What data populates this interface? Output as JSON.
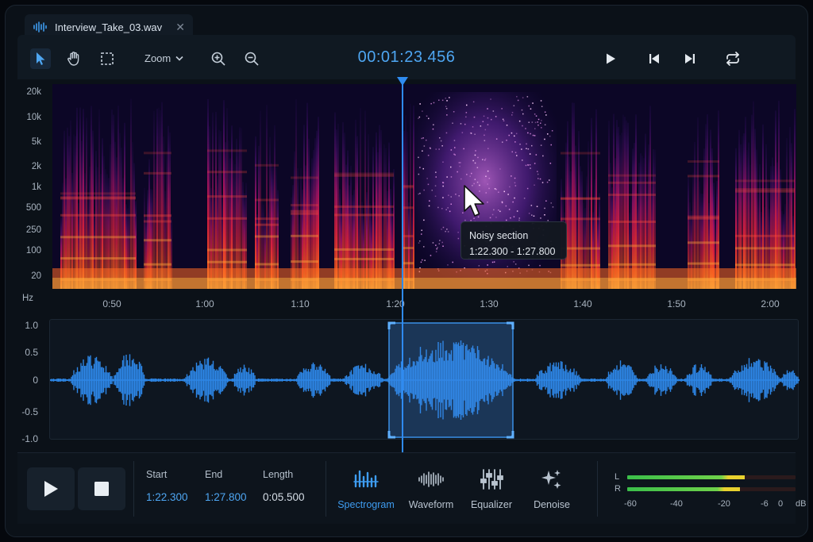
{
  "tab": {
    "filename": "Interview_Take_03.wav",
    "close_icon": "close-icon"
  },
  "toolbar": {
    "tools": [
      "select-arrow-icon",
      "hand-pan-icon",
      "marquee-select-icon"
    ],
    "zoom_label": "Zoom",
    "timecode": "00:01:23.456"
  },
  "spectrogram": {
    "freq_labels": [
      "20k",
      "10k",
      "5k",
      "2k",
      "1k",
      "500",
      "250",
      "100",
      "20"
    ],
    "unit": "Hz"
  },
  "time_axis": [
    "0:50",
    "1:00",
    "1:10",
    "1:20",
    "1:30",
    "1:40",
    "1:50",
    "2:00"
  ],
  "waveform": {
    "amp_labels": [
      "1.0",
      "0.5",
      "0",
      "-0.5",
      "-1.0"
    ]
  },
  "tooltip": {
    "title": "Noisy section",
    "range": "1:22.300 - 1:27.800"
  },
  "selection": {
    "start_label": "Start",
    "start_value": "1:22.300",
    "end_label": "End",
    "end_value": "1:27.800",
    "length_label": "Length",
    "length_value": "0:05.500"
  },
  "modes": [
    {
      "label": "Spectrogram",
      "icon": "spectrogram-icon",
      "active": true
    },
    {
      "label": "Waveform",
      "icon": "waveform-icon",
      "active": false
    },
    {
      "label": "Equalizer",
      "icon": "equalizer-icon",
      "active": false
    },
    {
      "label": "Denoise",
      "icon": "sparkle-denoise-icon",
      "active": false
    }
  ],
  "meter": {
    "channels": [
      "L",
      "R"
    ],
    "scale": [
      "-60",
      "-40",
      "-20",
      "-6",
      "0",
      "dB"
    ],
    "level_L_fraction": 0.7,
    "level_R_fraction": 0.67
  },
  "colors": {
    "accent": "#3e9cf0",
    "playhead": "#2f8bf0",
    "wave": "#2d86e6"
  }
}
